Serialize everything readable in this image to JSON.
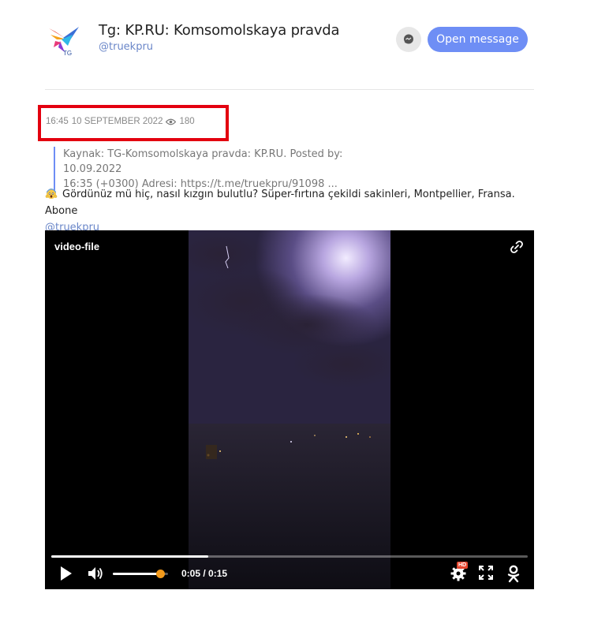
{
  "channel": {
    "title": "Tg: KP.RU: Komsomolskaya pravda",
    "handle": "@truekpru",
    "logo_text": "TG",
    "open_button_label": "Open message"
  },
  "post": {
    "time": "16:45",
    "date": "10 SEPTEMBER 2022",
    "views": "180",
    "quote_line1": "Kaynak: TG-Komsomolskaya pravda: KP.RU. Posted by: 10.09.2022",
    "quote_line2": "16:35 (+0300) Adresi: https://t.me/truekpru/91098 ...",
    "text": "Gördünüz mü hiç, nasıl kızgın bulutlu? Süper-fırtına çekildi sakinleri, Montpellier, Fransa. Abone",
    "mention": "@truekpru"
  },
  "video": {
    "label": "video-file",
    "current_time": "0:05",
    "duration": "0:15",
    "time_display": "0:05 / 0:15",
    "progress_fraction": 0.33,
    "volume_fraction": 0.85,
    "hd_badge": "HD"
  },
  "colors": {
    "accent": "#6e8ef5",
    "link": "#6a86c8",
    "highlight_box": "#e3000f",
    "volume_knob": "#f39a1b",
    "hd_badge": "#e5452e"
  },
  "icons": [
    "logo-icon",
    "message-icon",
    "eye-icon",
    "scream-emoji-icon",
    "link-icon",
    "play-icon",
    "volume-icon",
    "settings-icon",
    "fullscreen-icon",
    "odnoklassniki-icon"
  ]
}
